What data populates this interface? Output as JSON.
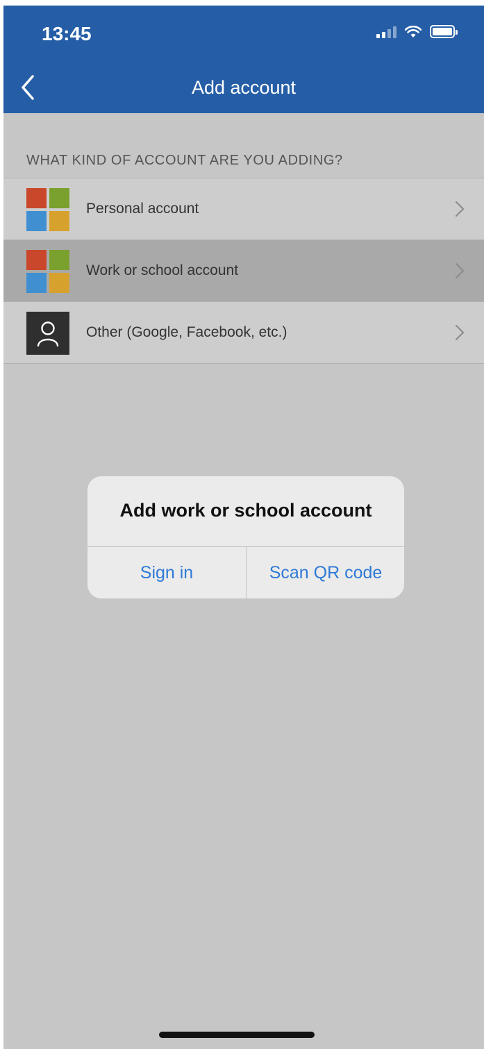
{
  "status_bar": {
    "time": "13:45",
    "icons": [
      "signal-icon",
      "wifi-icon",
      "battery-icon"
    ]
  },
  "nav": {
    "title": "Add account",
    "back_icon": "chevron-left-icon"
  },
  "section_header": "WHAT KIND OF ACCOUNT ARE YOU ADDING?",
  "accounts": [
    {
      "label": "Personal account",
      "icon": "microsoft-logo-icon",
      "highlighted": false
    },
    {
      "label": "Work or school account",
      "icon": "microsoft-logo-icon",
      "highlighted": true
    },
    {
      "label": "Other (Google, Facebook, etc.)",
      "icon": "person-icon",
      "highlighted": false
    }
  ],
  "alert": {
    "title": "Add work or school account",
    "buttons": [
      "Sign in",
      "Scan QR code"
    ]
  },
  "colors": {
    "nav_bar": "#255ea6",
    "background": "#c6c6c6",
    "row": "#cdcdcd",
    "row_highlight": "#a9a9a9",
    "alert_button": "#2f7ad6",
    "ms_red": "#c9472a",
    "ms_green": "#7aa02e",
    "ms_blue": "#3f8fd1",
    "ms_yellow": "#d7a12e"
  }
}
